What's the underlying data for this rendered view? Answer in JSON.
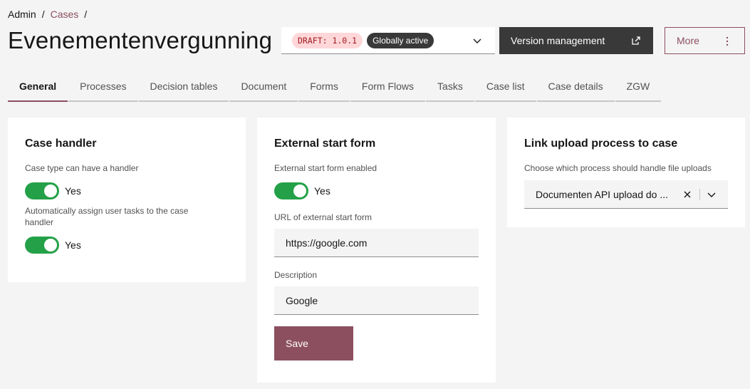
{
  "breadcrumb": {
    "root": "Admin",
    "sep1": "/",
    "cases": "Cases",
    "sep2": "/"
  },
  "page_title": "Evenementenvergunning",
  "version": {
    "draft_tag": "DRAFT: 1.0.1",
    "status_tag": "Globally active"
  },
  "header_buttons": {
    "version_management": "Version management",
    "more": "More"
  },
  "tabs": [
    "General",
    "Processes",
    "Decision tables",
    "Document",
    "Forms",
    "Form Flows",
    "Tasks",
    "Case list",
    "Case details",
    "ZGW"
  ],
  "active_tab": "General",
  "case_handler": {
    "title": "Case handler",
    "handler_label": "Case type can have a handler",
    "handler_value": "Yes",
    "assign_label": "Automatically assign user tasks to the case handler",
    "assign_value": "Yes"
  },
  "external_start_form": {
    "title": "External start form",
    "enabled_label": "External start form enabled",
    "enabled_value": "Yes",
    "url_label": "URL of external start form",
    "url_value": "https://google.com",
    "description_label": "Description",
    "description_value": "Google",
    "save_label": "Save"
  },
  "upload_process": {
    "title": "Link upload process to case",
    "select_label": "Choose which process should handle file uploads",
    "select_value": "Documenten API upload do ..."
  },
  "colors": {
    "accent": "#8c4f5f",
    "toggle_on": "#24a148",
    "dark_button": "#393939",
    "draft_tag_bg": "#ffd7d9"
  }
}
